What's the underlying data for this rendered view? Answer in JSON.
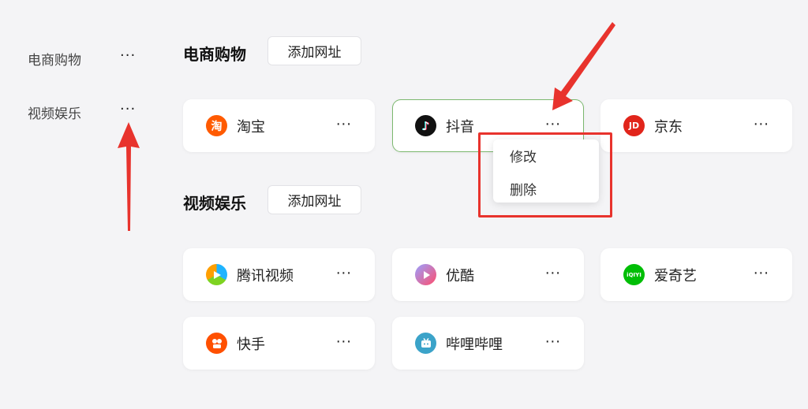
{
  "sidebar": {
    "items": [
      {
        "label": "电商购物",
        "more": "···"
      },
      {
        "label": "视频娱乐",
        "more": "···"
      }
    ]
  },
  "sections": [
    {
      "title": "电商购物",
      "add_label": "添加网址",
      "sites": [
        {
          "name": "淘宝",
          "icon": "taobao-icon",
          "glyph": "淘",
          "color": "#ff5a00",
          "more": "···"
        },
        {
          "name": "抖音",
          "icon": "douyin-icon",
          "glyph": "♪",
          "color": "#111111",
          "more": "···"
        },
        {
          "name": "京东",
          "icon": "jd-icon",
          "glyph": "JD",
          "color": "#e1251b",
          "more": "···"
        }
      ]
    },
    {
      "title": "视频娱乐",
      "add_label": "添加网址",
      "sites": [
        {
          "name": "腾讯视频",
          "icon": "tencent-video-icon",
          "color": "#1fb4ff",
          "more": "···"
        },
        {
          "name": "优酷",
          "icon": "youku-icon",
          "color": "#ff4d6d",
          "more": "···"
        },
        {
          "name": "爱奇艺",
          "icon": "iqiyi-icon",
          "glyph": "iQIYI",
          "color": "#00be06",
          "more": "···"
        },
        {
          "name": "快手",
          "icon": "kuaishou-icon",
          "color": "#ff5000",
          "more": "···"
        },
        {
          "name": "哔哩哔哩",
          "icon": "bilibili-icon",
          "color": "#3ba3c9",
          "more": "···"
        }
      ]
    }
  ],
  "context_menu": {
    "items": [
      {
        "label": "修改"
      },
      {
        "label": "删除"
      }
    ]
  },
  "annotation_color": "#e8332d"
}
